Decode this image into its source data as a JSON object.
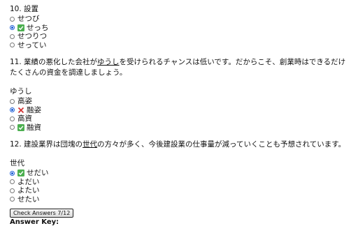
{
  "questions": [
    {
      "number_title": "10. 設置",
      "options": [
        {
          "label": "せつび",
          "selected": false,
          "mark": ""
        },
        {
          "label": "せっち",
          "selected": true,
          "mark": "check"
        },
        {
          "label": "せつりつ",
          "selected": false,
          "mark": ""
        },
        {
          "label": "せってい",
          "selected": false,
          "mark": ""
        }
      ]
    },
    {
      "sentence_pre": "11. 業績の悪化した会社が",
      "sentence_target": "ゆうし",
      "sentence_post": "を受けられるチャンスは低いです。だからこそ、創業時はできるだけたくさんの資金を調達しましょう。",
      "reading": "ゆうし",
      "options": [
        {
          "label": "高姿",
          "selected": false,
          "mark": ""
        },
        {
          "label": "融姿",
          "selected": true,
          "mark": "cross"
        },
        {
          "label": "高資",
          "selected": false,
          "mark": ""
        },
        {
          "label": "融資",
          "selected": false,
          "mark": "check"
        }
      ]
    },
    {
      "sentence_pre": "12. 建設業界は団塊の",
      "sentence_target": "世代",
      "sentence_post": "の方々が多く、今後建設業の仕事量が減っていくことも予想されています。",
      "reading": "世代",
      "options": [
        {
          "label": "せだい",
          "selected": true,
          "mark": "check"
        },
        {
          "label": "よだい",
          "selected": false,
          "mark": ""
        },
        {
          "label": "よたい",
          "selected": false,
          "mark": ""
        },
        {
          "label": "せたい",
          "selected": false,
          "mark": ""
        }
      ]
    }
  ],
  "check_button_label": "Check Answers 7/12",
  "answer_key_label": "Answer Key:",
  "colors": {
    "check_bg": "#4caf50",
    "cross": "#d32f2f",
    "radio_selected": "#1f5fd6"
  }
}
